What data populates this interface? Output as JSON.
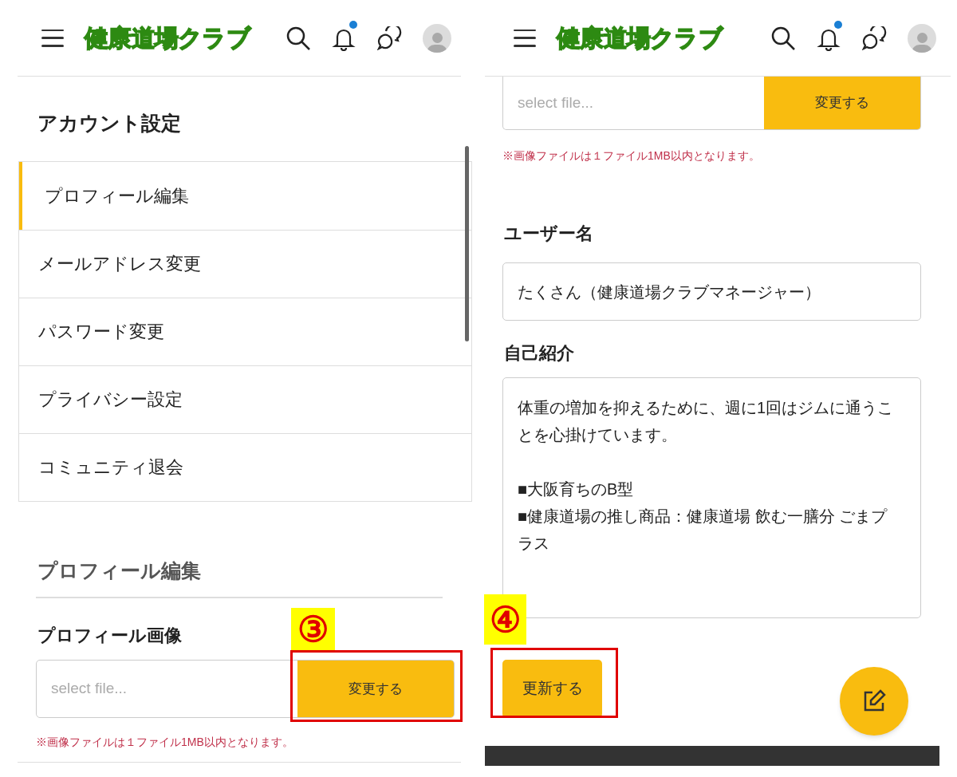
{
  "left_screen": {
    "header": {
      "logo": "健康道場クラブ",
      "notification_dot": true
    },
    "title": "アカウント設定",
    "menu": [
      {
        "label": "プロフィール編集",
        "selected": true
      },
      {
        "label": "メールアドレス変更",
        "selected": false
      },
      {
        "label": "パスワード変更",
        "selected": false
      },
      {
        "label": "プライバシー設定",
        "selected": false
      },
      {
        "label": "コミュニティ退会",
        "selected": false
      }
    ],
    "section_title": "プロフィール編集",
    "image_label": "プロフィール画像",
    "file_placeholder": "select file...",
    "change_button": "変更する",
    "note": "※画像ファイルは１ファイル1MB以内となります。",
    "annotation": "③"
  },
  "right_screen": {
    "header": {
      "logo": "健康道場クラブ",
      "notification_dot": true
    },
    "file_placeholder": "select file...",
    "change_button": "変更する",
    "note": "※画像ファイルは１ファイル1MB以内となります。",
    "username_label": "ユーザー名",
    "username_value": "たくさん（健康道場クラブマネージャー）",
    "bio_label": "自己紹介",
    "bio_value": "体重の増加を抑えるために、週に1回はジムに通うことを心掛けています。\n\n■大阪育ちのB型\n■健康道場の推し商品：健康道場 飲む一膳分 ごまプラス",
    "update_button": "更新する",
    "annotation": "④"
  }
}
